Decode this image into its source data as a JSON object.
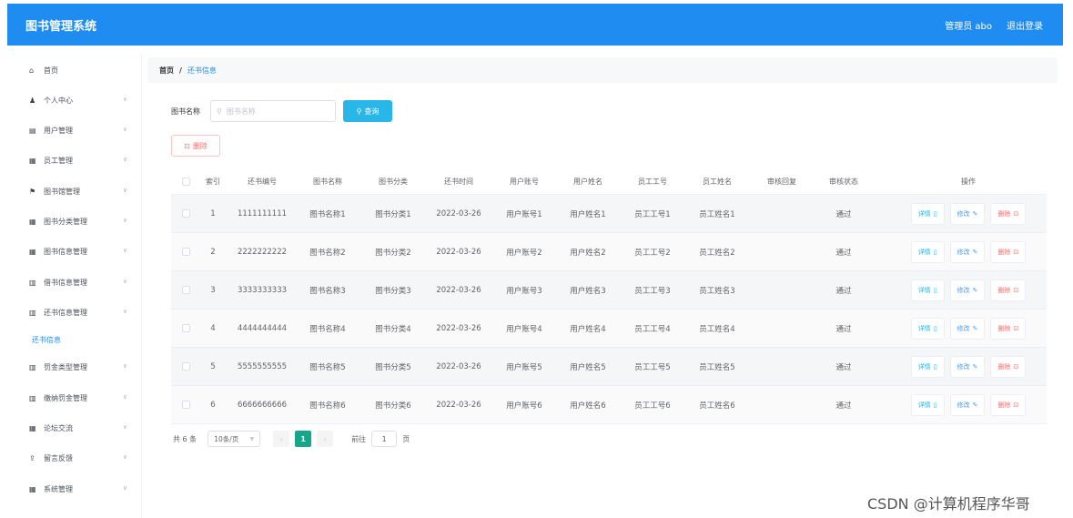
{
  "header": {
    "title": "图书管理系统",
    "user": "管理员 abo",
    "logout": "退出登录"
  },
  "sidebar": {
    "items": [
      {
        "label": "首页",
        "icon": "home-icon",
        "glyph": "⌂",
        "chevron": false
      },
      {
        "label": "个人中心",
        "icon": "user-icon",
        "glyph": "♟",
        "chevron": true
      },
      {
        "label": "用户管理",
        "icon": "grid-icon",
        "glyph": "▤",
        "chevron": true
      },
      {
        "label": "员工管理",
        "icon": "grid-icon",
        "glyph": "▦",
        "chevron": true
      },
      {
        "label": "图书馆管理",
        "icon": "flag-icon",
        "glyph": "⚑",
        "chevron": true
      },
      {
        "label": "图书分类管理",
        "icon": "grid-icon",
        "glyph": "▦",
        "chevron": true
      },
      {
        "label": "图书信息管理",
        "icon": "grid-icon",
        "glyph": "▦",
        "chevron": true
      },
      {
        "label": "借书信息管理",
        "icon": "doc-icon",
        "glyph": "▥",
        "chevron": true
      },
      {
        "label": "还书信息管理",
        "icon": "doc-icon",
        "glyph": "▥",
        "chevron": true
      },
      {
        "label": "罚金类型管理",
        "icon": "doc-icon",
        "glyph": "▥",
        "chevron": true
      },
      {
        "label": "缴纳罚金管理",
        "icon": "doc-icon",
        "glyph": "▥",
        "chevron": true
      },
      {
        "label": "论坛交流",
        "icon": "grid-icon",
        "glyph": "▦",
        "chevron": true
      },
      {
        "label": "留言反馈",
        "icon": "upload-icon",
        "glyph": "⇪",
        "chevron": true
      },
      {
        "label": "系统管理",
        "icon": "grid-icon",
        "glyph": "▦",
        "chevron": true
      }
    ],
    "sub_item": "还书信息"
  },
  "breadcrumb": {
    "home": "首页",
    "sep": "/",
    "current": "还书信息"
  },
  "search": {
    "label": "图书名称",
    "placeholder": "图书名称",
    "button": "查询"
  },
  "actions": {
    "delete": "删除"
  },
  "table": {
    "headers": [
      "索引",
      "还书编号",
      "图书名称",
      "图书分类",
      "还书时间",
      "用户账号",
      "用户姓名",
      "员工工号",
      "员工姓名",
      "审核回复",
      "审核状态",
      "操作"
    ],
    "rows": [
      [
        "1",
        "1111111111",
        "图书名称1",
        "图书分类1",
        "2022-03-26",
        "用户账号1",
        "用户姓名1",
        "员工工号1",
        "员工姓名1",
        "",
        "通过"
      ],
      [
        "2",
        "2222222222",
        "图书名称2",
        "图书分类2",
        "2022-03-26",
        "用户账号2",
        "用户姓名2",
        "员工工号2",
        "员工姓名2",
        "",
        "通过"
      ],
      [
        "3",
        "3333333333",
        "图书名称3",
        "图书分类3",
        "2022-03-26",
        "用户账号3",
        "用户姓名3",
        "员工工号3",
        "员工姓名3",
        "",
        "通过"
      ],
      [
        "4",
        "4444444444",
        "图书名称4",
        "图书分类4",
        "2022-03-26",
        "用户账号4",
        "用户姓名4",
        "员工工号4",
        "员工姓名4",
        "",
        "通过"
      ],
      [
        "5",
        "5555555555",
        "图书名称5",
        "图书分类5",
        "2022-03-26",
        "用户账号5",
        "用户姓名5",
        "员工工号5",
        "员工姓名5",
        "",
        "通过"
      ],
      [
        "6",
        "6666666666",
        "图书名称6",
        "图书分类6",
        "2022-03-26",
        "用户账号6",
        "用户姓名6",
        "员工工号6",
        "员工姓名6",
        "",
        "通过"
      ]
    ],
    "op_detail": "详情",
    "op_edit": "修改",
    "op_delete": "删除"
  },
  "pagination": {
    "total": "共 6 条",
    "page_size": "10条/页",
    "prev": "‹",
    "current": "1",
    "next": "›",
    "goto": "前往",
    "goto_value": "1",
    "page_unit": "页"
  },
  "watermark": "CSDN @计算机程序华哥"
}
